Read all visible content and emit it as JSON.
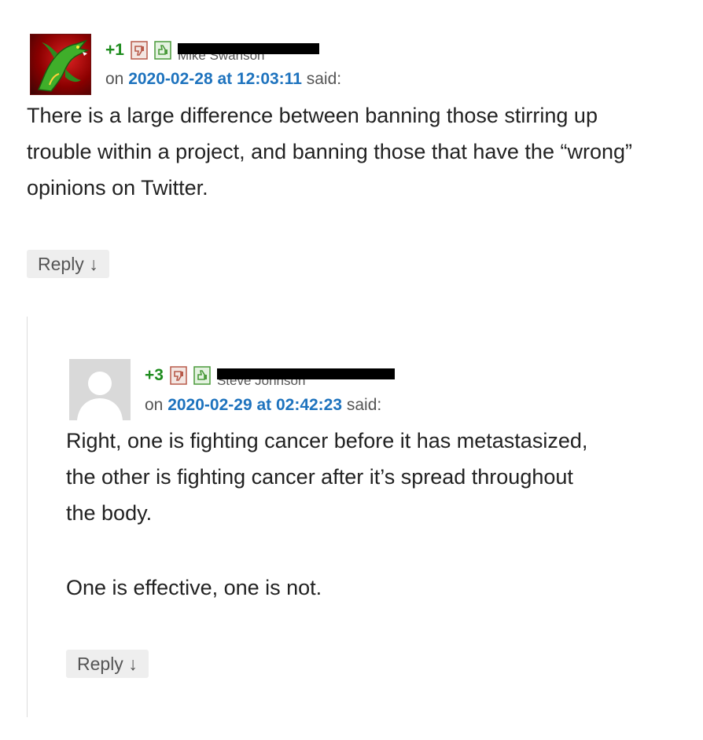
{
  "comments": [
    {
      "score": "+1",
      "author": "Mike Swanson",
      "on_text": "on",
      "date_link": "2020-02-28 at 12:03:11",
      "said_text": "said:",
      "paragraphs": [
        "There is a large difference between banning those stirring up trouble within a project, and banning those that have the “wrong” opinions on Twitter."
      ],
      "reply_label": "Reply ↓"
    },
    {
      "score": "+3",
      "author": "Steve Johnson",
      "on_text": "on",
      "date_link": "2020-02-29 at 02:42:23",
      "said_text": "said:",
      "paragraphs": [
        "Right, one is fighting cancer before it has metastasized, the other is fighting cancer after it’s spread throughout the body.",
        "One is effective, one is not."
      ],
      "reply_label": "Reply ↓"
    }
  ],
  "colors": {
    "score": "#1e8c1e",
    "date_link": "#1e73be",
    "vote_down": "#b85a4a",
    "vote_up": "#4a9a3a"
  },
  "icons": {
    "vote_down": "thumbs-down-icon",
    "vote_up": "thumbs-up-icon"
  }
}
